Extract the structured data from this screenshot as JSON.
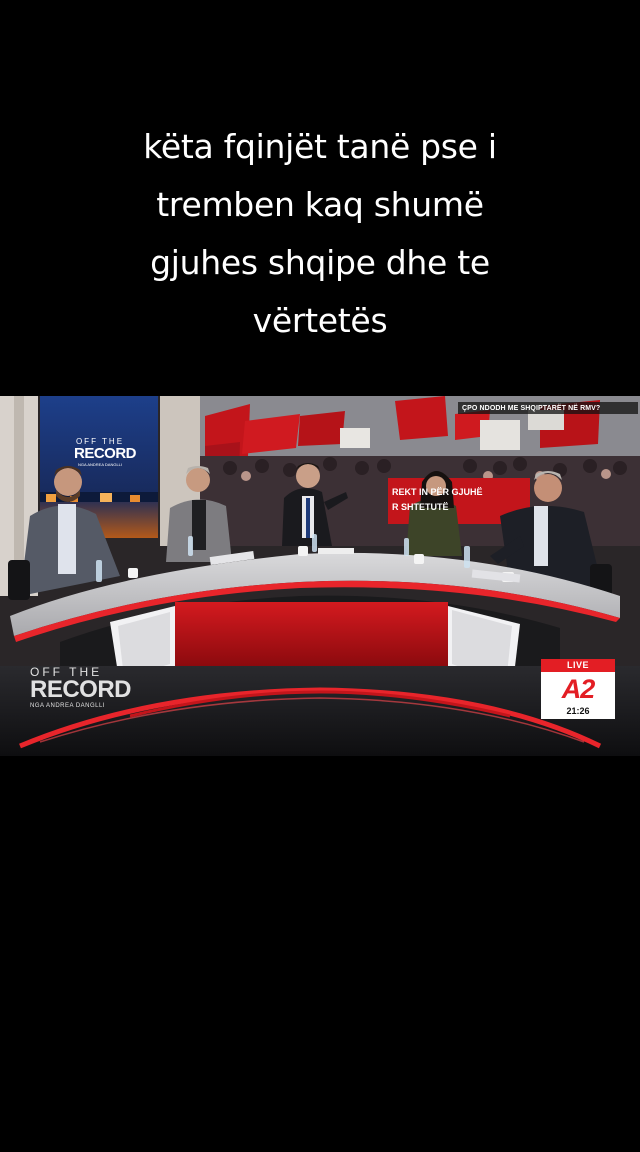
{
  "caption": {
    "lines": [
      "këta fqinjët tanë pse i",
      "tremben kaq shumë",
      "gjuhes shqipe dhe te",
      "vërtetës"
    ]
  },
  "broadcast": {
    "ticker": "ÇPO NDODH ME SHQIPTARËT NË RMV?",
    "wall_title": {
      "top": "OFF THE",
      "main": "RECORD",
      "sub": "NGA ANDREA DANGLLI"
    },
    "banner_lines": [
      "REKT    IN PËR GJUHË",
      "R         SHTETUTË"
    ],
    "show_logo": {
      "top": "OFF THE",
      "main": "RECORD",
      "sub": "NGA ANDREA DANGLLI"
    },
    "live_label": "LIVE",
    "channel": "A2",
    "time": "21:26"
  },
  "colors": {
    "accent_red": "#e31e24",
    "background": "#000000"
  }
}
